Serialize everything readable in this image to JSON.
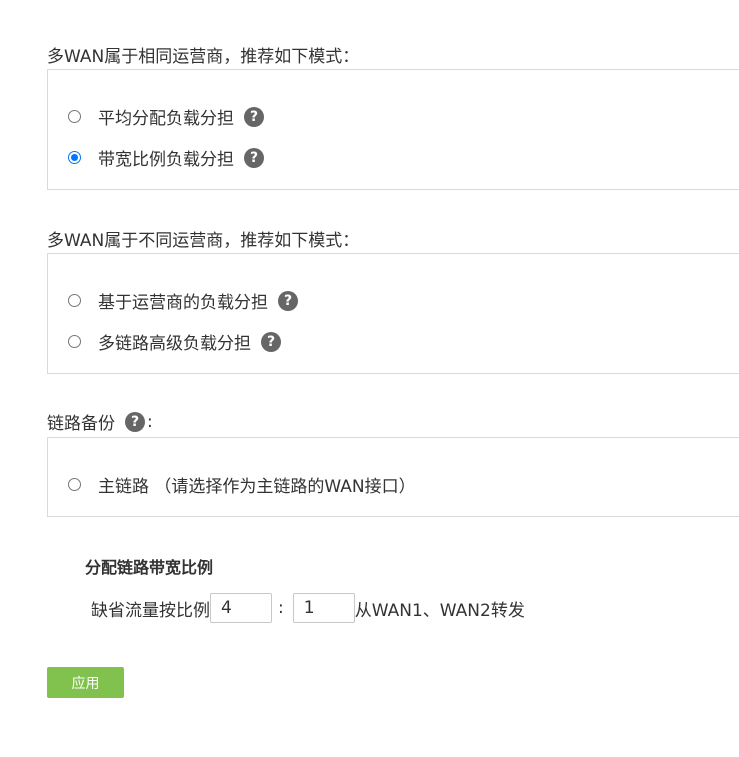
{
  "same_isp": {
    "title": "多WAN属于相同运营商，推荐如下模式：",
    "options": [
      {
        "label": "平均分配负载分担",
        "checked": false
      },
      {
        "label": "带宽比例负载分担",
        "checked": true
      }
    ]
  },
  "diff_isp": {
    "title": "多WAN属于不同运营商，推荐如下模式：",
    "options": [
      {
        "label": "基于运营商的负载分担",
        "checked": false
      },
      {
        "label": "多链路高级负载分担",
        "checked": false
      }
    ]
  },
  "backup": {
    "title": "链路备份",
    "title_suffix": ":",
    "options": [
      {
        "label": "主链路 （请选择作为主链路的WAN接口）",
        "checked": false
      }
    ]
  },
  "help_icon_glyph": "?",
  "ratio": {
    "title": "分配链路带宽比例",
    "label": "缺省流量按比例",
    "value1": "4",
    "separator": ":",
    "value2": "1",
    "suffix": "从WAN1、WAN2转发"
  },
  "apply_label": "应用",
  "colors": {
    "accent_radio": "#0075ff",
    "apply_button": "#80c24d",
    "help_icon": "#666666",
    "border": "#d9d9d9"
  }
}
